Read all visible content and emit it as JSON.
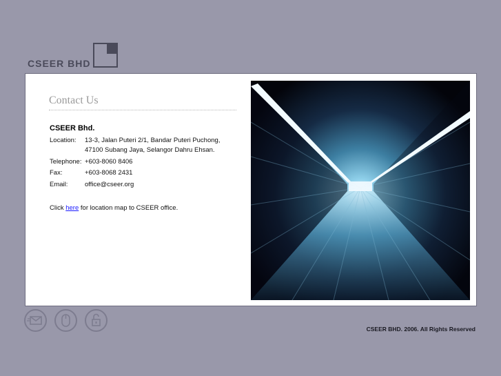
{
  "logo": {
    "text": "CSEER BHD"
  },
  "contact": {
    "heading": "Contact Us",
    "company": "CSEER Bhd.",
    "location_label": "Location:",
    "location_line1": "13-3, Jalan Puteri 2/1, Bandar Puteri Puchong,",
    "location_line2": "47100 Subang Jaya, Selangor Dahru Ehsan.",
    "telephone_label": "Telephone:",
    "telephone_value": "+603-8060 8406",
    "fax_label": "Fax:",
    "fax_value": "+603-8068 2431",
    "email_label": "Email:",
    "email_value": "office@cseer.org",
    "click_prefix": "Click",
    "click_link": "here",
    "click_suffix": "for location map to CSEER office."
  },
  "footer": {
    "icons": [
      "email-icon",
      "mouse-icon",
      "lock-icon"
    ],
    "copyright": "CSEER BHD. 2006. All Rights Reserved"
  },
  "colors": {
    "background": "#9998aa",
    "panel": "#ffffff",
    "logo": "#4a4a5a",
    "link": "#1a1aff"
  }
}
